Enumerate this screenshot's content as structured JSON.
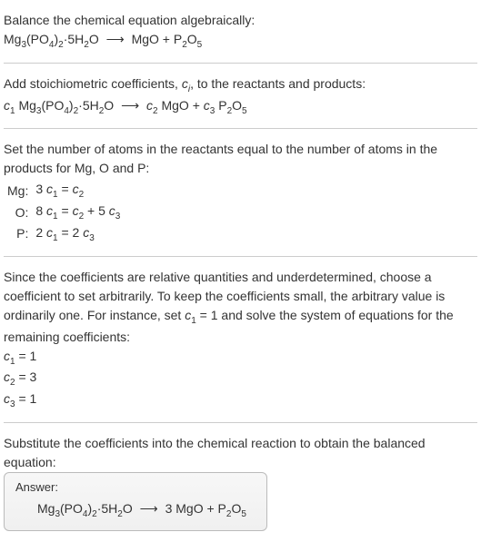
{
  "intro": {
    "line1": "Balance the chemical equation algebraically:",
    "eq_left": "Mg",
    "eq_left_sub1": "3",
    "eq_left2": "(PO",
    "eq_left_sub2": "4",
    "eq_left3": ")",
    "eq_left_sub3": "2",
    "eq_left4": "·5H",
    "eq_left_sub4": "2",
    "eq_left5": "O",
    "arrow": "⟶",
    "eq_right1": "MgO + P",
    "eq_right_sub1": "2",
    "eq_right2": "O",
    "eq_right_sub2": "5"
  },
  "stoich": {
    "text1": "Add stoichiometric coefficients, ",
    "ci": "c",
    "ci_sub": "i",
    "text2": ", to the reactants and products:",
    "c1": "c",
    "c1s": "1",
    "sp1": " Mg",
    "s1": "3",
    "sp2": "(PO",
    "s2": "4",
    "sp3": ")",
    "s3": "2",
    "sp4": "·5H",
    "s4": "2",
    "sp5": "O",
    "arrow": "⟶",
    "c2": "c",
    "c2s": "2",
    "sp6": " MgO + ",
    "c3": "c",
    "c3s": "3",
    "sp7": " P",
    "s5": "2",
    "sp8": "O",
    "s6": "5"
  },
  "atoms": {
    "text": "Set the number of atoms in the reactants equal to the number of atoms in the products for Mg, O and P:",
    "rows": [
      {
        "lbl": "Mg:",
        "eq_a": "3 ",
        "c1": "c",
        "c1s": "1",
        "mid": " = ",
        "c2": "c",
        "c2s": "2",
        "tail": ""
      },
      {
        "lbl": "O:",
        "eq_a": "8 ",
        "c1": "c",
        "c1s": "1",
        "mid": " = ",
        "c2": "c",
        "c2s": "2",
        "tail_a": " + 5 ",
        "c3": "c",
        "c3s": "3"
      },
      {
        "lbl": "P:",
        "eq_a": "2 ",
        "c1": "c",
        "c1s": "1",
        "mid": " = 2 ",
        "c2": "c",
        "c2s": "3",
        "tail": ""
      }
    ]
  },
  "since": {
    "text_a": "Since the coefficients are relative quantities and underdetermined, choose a coefficient to set arbitrarily. To keep the coefficients small, the arbitrary value is ordinarily one. For instance, set ",
    "c1": "c",
    "c1s": "1",
    "text_b": " = 1 and solve the system of equations for the remaining coefficients:",
    "lines": [
      {
        "c": "c",
        "cs": "1",
        "val": " = 1"
      },
      {
        "c": "c",
        "cs": "2",
        "val": " = 3"
      },
      {
        "c": "c",
        "cs": "3",
        "val": " = 1"
      }
    ]
  },
  "subst": {
    "text": "Substitute the coefficients into the chemical reaction to obtain the balanced equation:"
  },
  "answer": {
    "label": "Answer:",
    "eq_a": "Mg",
    "s1": "3",
    "eq_b": "(PO",
    "s2": "4",
    "eq_c": ")",
    "s3": "2",
    "eq_d": "·5H",
    "s4": "2",
    "eq_e": "O",
    "arrow": "⟶",
    "eq_f": "3 MgO + P",
    "s5": "2",
    "eq_g": "O",
    "s6": "5"
  }
}
